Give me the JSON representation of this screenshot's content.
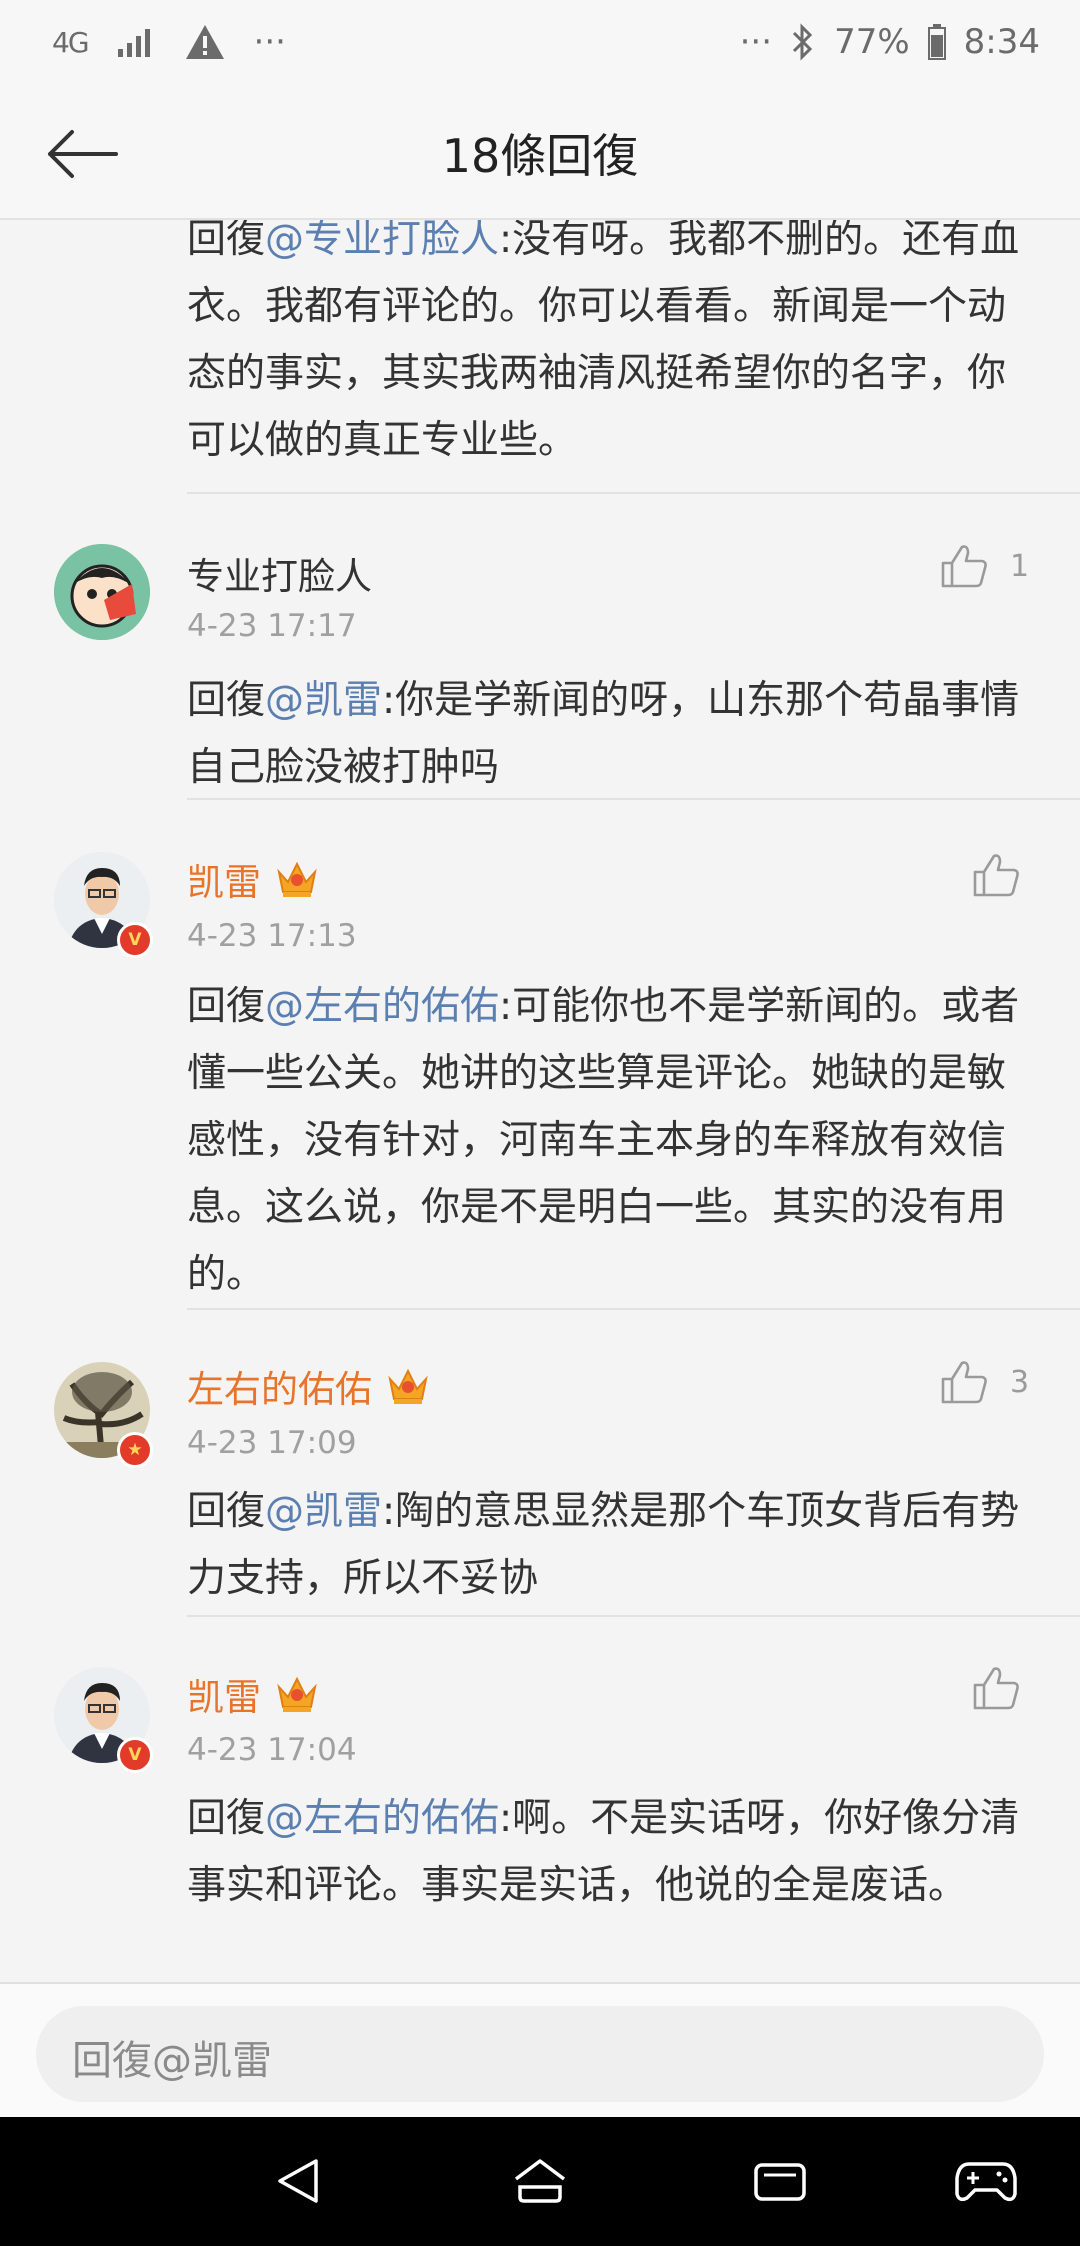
{
  "status": {
    "network": "4G",
    "more_left": "···",
    "more_right": "···",
    "battery": "77%",
    "time": "8:34"
  },
  "header": {
    "title": "18條回復"
  },
  "comments": [
    {
      "parts": [
        {
          "t": "回復",
          "m": false
        },
        {
          "t": "@专业打脸人",
          "m": true
        },
        {
          "t": ":没有呀。我都不删的。还有血衣。我都有评论的。你可以看看。新闻是一个动态的事实，其实我两袖清风挺希望你的名字，你可以做的真正专业些。",
          "m": false
        }
      ]
    },
    {
      "name": "专业打脸人",
      "time": "4-23 17:17",
      "likes": "1",
      "parts": [
        {
          "t": "回復",
          "m": false
        },
        {
          "t": "@凯雷",
          "m": true
        },
        {
          "t": ":你是学新闻的呀，山东那个苟晶事情自己脸没被打肿吗",
          "m": false
        }
      ]
    },
    {
      "name": "凯雷",
      "time": "4-23 17:13",
      "likes": "",
      "parts": [
        {
          "t": "回復",
          "m": false
        },
        {
          "t": "@左右的佑佑",
          "m": true
        },
        {
          "t": ":可能你也不是学新闻的。或者懂一些公关。她讲的这些算是评论。她缺的是敏感性，没有针对，河南车主本身的车释放有效信息。这么说，你是不是明白一些。其实的没有用的。",
          "m": false
        }
      ]
    },
    {
      "name": "左右的佑佑",
      "time": "4-23 17:09",
      "likes": "3",
      "parts": [
        {
          "t": "回復",
          "m": false
        },
        {
          "t": "@凯雷",
          "m": true
        },
        {
          "t": ":陶的意思显然是那个车顶女背后有势力支持，所以不妥协",
          "m": false
        }
      ]
    },
    {
      "name": "凯雷",
      "time": "4-23 17:04",
      "likes": "",
      "parts": [
        {
          "t": "回復",
          "m": false
        },
        {
          "t": "@左右的佑佑",
          "m": true
        },
        {
          "t": ":啊。不是实话呀，你好像分清事实和评论。事实是实话，他说的全是废话。",
          "m": false
        }
      ]
    }
  ],
  "reply_bar": {
    "placeholder": "回復@凯雷"
  },
  "colors": {
    "mention": "#5a7fb0",
    "vip_name": "#e8742b",
    "time": "#a0a0a0",
    "background": "#f4f4f4"
  },
  "icons": [
    "signal-4g-icon",
    "signal-bars-icon",
    "warning-icon",
    "bluetooth-icon",
    "battery-icon",
    "back-arrow-icon",
    "thumbs-up-icon",
    "crown-icon",
    "verified-v-icon",
    "nav-back-icon",
    "nav-home-icon",
    "nav-recents-icon",
    "game-controller-icon"
  ]
}
